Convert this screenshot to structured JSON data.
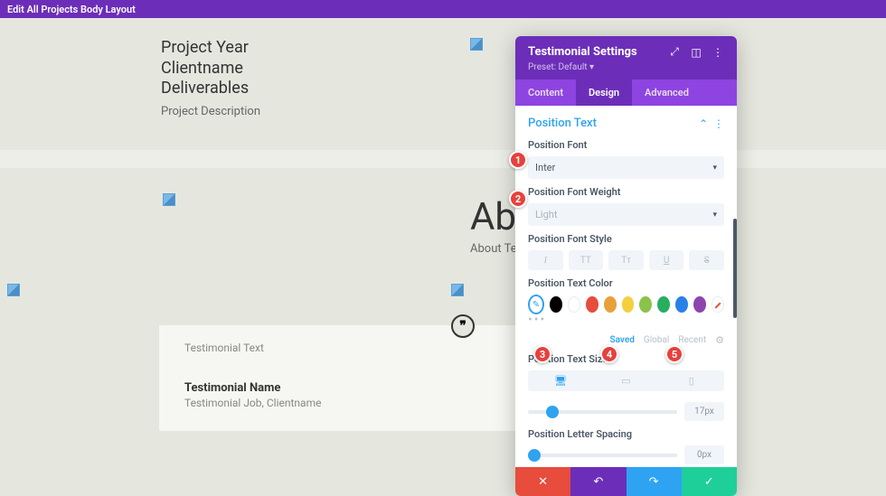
{
  "topbar": {
    "title": "Edit All Projects Body Layout"
  },
  "project": {
    "year": "Project Year",
    "client": "Clientname",
    "deliverables": "Deliverables",
    "desc": "Project Description"
  },
  "about": {
    "heading": "About",
    "text": "About Text"
  },
  "testimonial": {
    "text": "Testimonial Text",
    "name": "Testimonial Name",
    "job": "Testimonial Job, Clientname",
    "quote": "❞"
  },
  "panel": {
    "title": "Testimonial Settings",
    "preset": "Preset: Default ▾",
    "tabs": {
      "content": "Content",
      "design": "Design",
      "advanced": "Advanced"
    },
    "section": "Position Text",
    "labels": {
      "font": "Position Font",
      "weight": "Position Font Weight",
      "style": "Position Font Style",
      "color": "Position Text Color",
      "size": "Position Text Size",
      "spacing": "Position Letter Spacing"
    },
    "font_value": "Inter",
    "weight_value": "Light",
    "style_btns": {
      "italic": "I",
      "upper": "TT",
      "small": "Tᴛ",
      "under": "U",
      "strike": "S"
    },
    "color_tabs": {
      "saved": "Saved",
      "global": "Global",
      "recent": "Recent"
    },
    "size_value": "17px",
    "spacing_value": "0px",
    "colors": {
      "black": "#000000",
      "white": "#ffffff",
      "red": "#e74c3c",
      "orange": "#e8a13a",
      "yellow": "#f4d03f",
      "lime": "#8bc34a",
      "green": "#27ae60",
      "blue": "#2980e7",
      "purple": "#8e44ad"
    }
  },
  "badges": {
    "b1": "1",
    "b2": "2",
    "b3": "3",
    "b4": "4",
    "b5": "5"
  }
}
